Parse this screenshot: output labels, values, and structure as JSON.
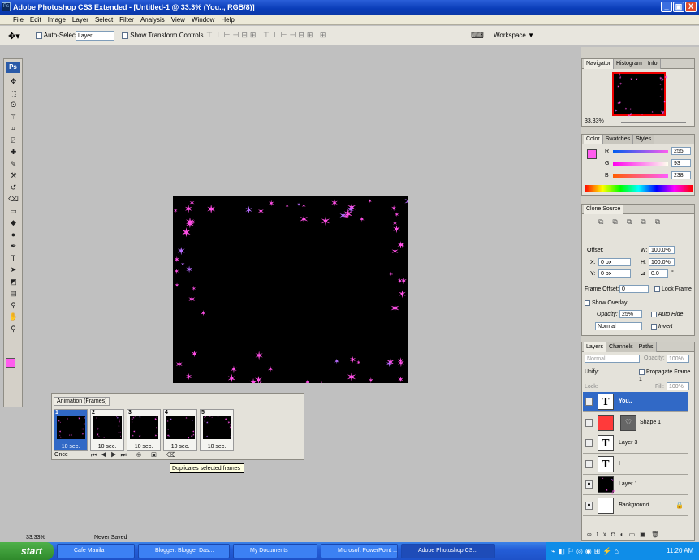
{
  "window": {
    "title": "Adobe Photoshop CS3 Extended - [Untitled-1 @ 33.3% (You.., RGB/8)]",
    "app_icon": "Ps",
    "minimize": "_",
    "restore": "▣",
    "close": "X"
  },
  "menubar": {
    "items": [
      "File",
      "Edit",
      "Image",
      "Layer",
      "Select",
      "Filter",
      "Analysis",
      "View",
      "Window",
      "Help"
    ]
  },
  "options": {
    "auto_select_label": "Auto-Select:",
    "auto_select_value": "Layer",
    "show_transform_label": "Show Transform Controls",
    "workspace_label": "Workspace ▼"
  },
  "toolbox": {
    "ps_logo": "Ps",
    "tools": [
      "move",
      "marquee",
      "lasso",
      "magic-wand",
      "crop",
      "slice",
      "healing",
      "brush",
      "stamp",
      "history-brush",
      "eraser",
      "gradient",
      "blur",
      "dodge",
      "pen",
      "type",
      "path-select",
      "shape",
      "notes",
      "eyedropper",
      "hand",
      "zoom"
    ]
  },
  "navigator": {
    "tabs": [
      "Navigator",
      "Histogram",
      "Info"
    ],
    "zoom": "33.33%"
  },
  "color": {
    "tabs": [
      "Color",
      "Swatches",
      "Styles"
    ],
    "r_label": "R",
    "g_label": "G",
    "b_label": "B",
    "r": "255",
    "g": "93",
    "b": "238",
    "foreground": "#ff5dee"
  },
  "clone_source": {
    "tab": "Clone Source",
    "offset_label": "Offset:",
    "x_label": "X:",
    "x": "0 px",
    "y_label": "Y:",
    "y": "0 px",
    "w_label": "W:",
    "w": "100.0%",
    "h_label": "H:",
    "h": "100.0%",
    "angle": "0.0",
    "angle_unit": "°",
    "frame_offset_label": "Frame Offset:",
    "frame_offset": "0",
    "lock_frame": "Lock Frame",
    "show_overlay": "Show Overlay",
    "opacity_label": "Opacity:",
    "opacity": "25%",
    "auto_hide": "Auto Hide",
    "invert": "Invert",
    "mode": "Normal"
  },
  "layers": {
    "tabs": [
      "Layers",
      "Channels",
      "Paths"
    ],
    "blend": "Normal",
    "opacity_label": "Opacity:",
    "opacity": "100%",
    "unify_label": "Unify:",
    "propagate": "Propagate Frame 1",
    "lock_label": "Lock:",
    "fill_label": "Fill:",
    "fill": "100%",
    "items": [
      {
        "name": "You..",
        "kind": "T",
        "selected": true
      },
      {
        "name": "Shape 1",
        "kind": "shape"
      },
      {
        "name": "Layer 3",
        "kind": "T"
      },
      {
        "name": "I",
        "kind": "T"
      },
      {
        "name": "Layer 1",
        "kind": "img"
      },
      {
        "name": "Background",
        "kind": "bg"
      }
    ]
  },
  "animation": {
    "title": "Animation (Frames)",
    "loop": "Once",
    "frames": [
      {
        "num": "1",
        "delay": "10 sec."
      },
      {
        "num": "2",
        "delay": "10 sec."
      },
      {
        "num": "3",
        "delay": "10 sec."
      },
      {
        "num": "4",
        "delay": "10 sec."
      },
      {
        "num": "5",
        "delay": "10 sec."
      }
    ],
    "tooltip": "Duplicates selected frames"
  },
  "status": {
    "zoom": "33.33%",
    "doc": "Never Saved"
  },
  "taskbar": {
    "start": "start",
    "tasks": [
      "Cafe Manila",
      "Blogger: Blogger Das...",
      "My Documents",
      "Microsoft PowerPoint ...",
      "Adobe Photoshop CS..."
    ],
    "clock": "11:20 AM"
  }
}
